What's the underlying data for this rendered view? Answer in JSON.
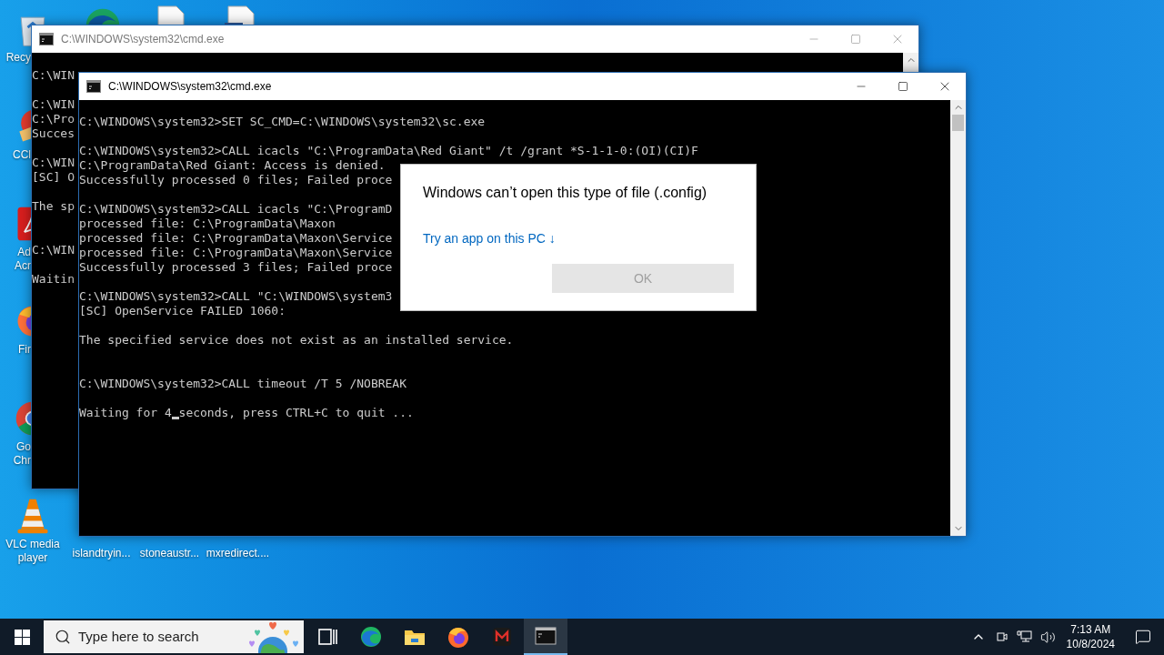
{
  "desktop": {
    "top_row": [
      {
        "kind": "edge"
      },
      {
        "kind": "document"
      },
      {
        "kind": "word"
      }
    ],
    "left_column": [
      {
        "kind": "recycle-bin",
        "label_lines": [
          "Recy"
        ]
      },
      {
        "kind": "ccleaner",
        "label_lines": [
          "CCl"
        ]
      },
      {
        "kind": "acrobat",
        "label_lines": [
          "Ad",
          "Acr"
        ]
      },
      {
        "kind": "firefox",
        "label_lines": [
          "Fir"
        ]
      },
      {
        "kind": "chrome",
        "label_lines": [
          "Go",
          "Chr"
        ]
      },
      {
        "kind": "vlc",
        "label_lines": [
          "VLC media",
          "player"
        ]
      }
    ],
    "bottom_row": [
      {
        "label": "islandtryin..."
      },
      {
        "label": "stoneaustr..."
      },
      {
        "label": "mxredirect...."
      }
    ]
  },
  "windows": [
    {
      "title": "C:\\WINDOWS\\system32\\cmd.exe",
      "active": false,
      "lines": [
        {
          "kind": "text",
          "text": "C:\\WIN"
        },
        {
          "kind": "blank"
        },
        {
          "kind": "text",
          "text": "C:\\WIN"
        },
        {
          "kind": "text",
          "text": "C:\\Pro"
        },
        {
          "kind": "text",
          "text": "Succes"
        },
        {
          "kind": "blank"
        },
        {
          "kind": "text",
          "text": "C:\\WIN"
        },
        {
          "kind": "text",
          "text": "[SC] O"
        },
        {
          "kind": "blank"
        },
        {
          "kind": "text",
          "text": "The sp"
        },
        {
          "kind": "blank"
        },
        {
          "kind": "blank"
        },
        {
          "kind": "text",
          "text": "C:\\WIN"
        },
        {
          "kind": "blank"
        },
        {
          "kind": "text",
          "text": "Waitin"
        }
      ]
    },
    {
      "title": "C:\\WINDOWS\\system32\\cmd.exe",
      "active": true,
      "lines": [
        {
          "kind": "text",
          "text": "C:\\WINDOWS\\system32>SET SC_CMD=C:\\WINDOWS\\system32\\sc.exe"
        },
        {
          "kind": "blank"
        },
        {
          "kind": "text",
          "text": "C:\\WINDOWS\\system32>CALL icacls \"C:\\ProgramData\\Red Giant\" /t /grant *S-1-1-0:(OI)(CI)F"
        },
        {
          "kind": "text",
          "text": "C:\\ProgramData\\Red Giant: Access is denied."
        },
        {
          "kind": "text",
          "text": "Successfully processed 0 files; Failed proce"
        },
        {
          "kind": "blank"
        },
        {
          "kind": "text",
          "text": "C:\\WINDOWS\\system32>CALL icacls \"C:\\ProgramD"
        },
        {
          "kind": "text",
          "text": "processed file: C:\\ProgramData\\Maxon"
        },
        {
          "kind": "text",
          "text": "processed file: C:\\ProgramData\\Maxon\\Service"
        },
        {
          "kind": "text",
          "text": "processed file: C:\\ProgramData\\Maxon\\Service"
        },
        {
          "kind": "text",
          "text": "Successfully processed 3 files; Failed proce"
        },
        {
          "kind": "blank"
        },
        {
          "kind": "text",
          "text": "C:\\WINDOWS\\system32>CALL \"C:\\WINDOWS\\system3"
        },
        {
          "kind": "text",
          "text": "[SC] OpenService FAILED 1060:"
        },
        {
          "kind": "blank"
        },
        {
          "kind": "text",
          "text": "The specified service does not exist as an installed service."
        },
        {
          "kind": "blank"
        },
        {
          "kind": "blank"
        },
        {
          "kind": "text",
          "text": "C:\\WINDOWS\\system32>CALL timeout /T 5 /NOBREAK"
        },
        {
          "kind": "blank"
        },
        {
          "kind": "cursor",
          "text": "Waiting for 4",
          "after": "seconds, press CTRL+C to quit ..."
        }
      ]
    }
  ],
  "dialog": {
    "title": "Windows can’t open this type of file (.config)",
    "link": "Try an app on this PC ↓",
    "button": {
      "label": "OK",
      "disabled": true
    }
  },
  "taskbar": {
    "search": {
      "placeholder": "Type here to search"
    },
    "apps": [
      {
        "kind": "task-view",
        "active": false
      },
      {
        "kind": "edge",
        "active": false
      },
      {
        "kind": "folder",
        "active": false
      },
      {
        "kind": "firefox",
        "active": false
      },
      {
        "kind": "m-app",
        "active": false
      },
      {
        "kind": "terminal",
        "active": true
      }
    ],
    "clock": {
      "time": "7:13 AM",
      "date": "10/8/2024"
    }
  }
}
